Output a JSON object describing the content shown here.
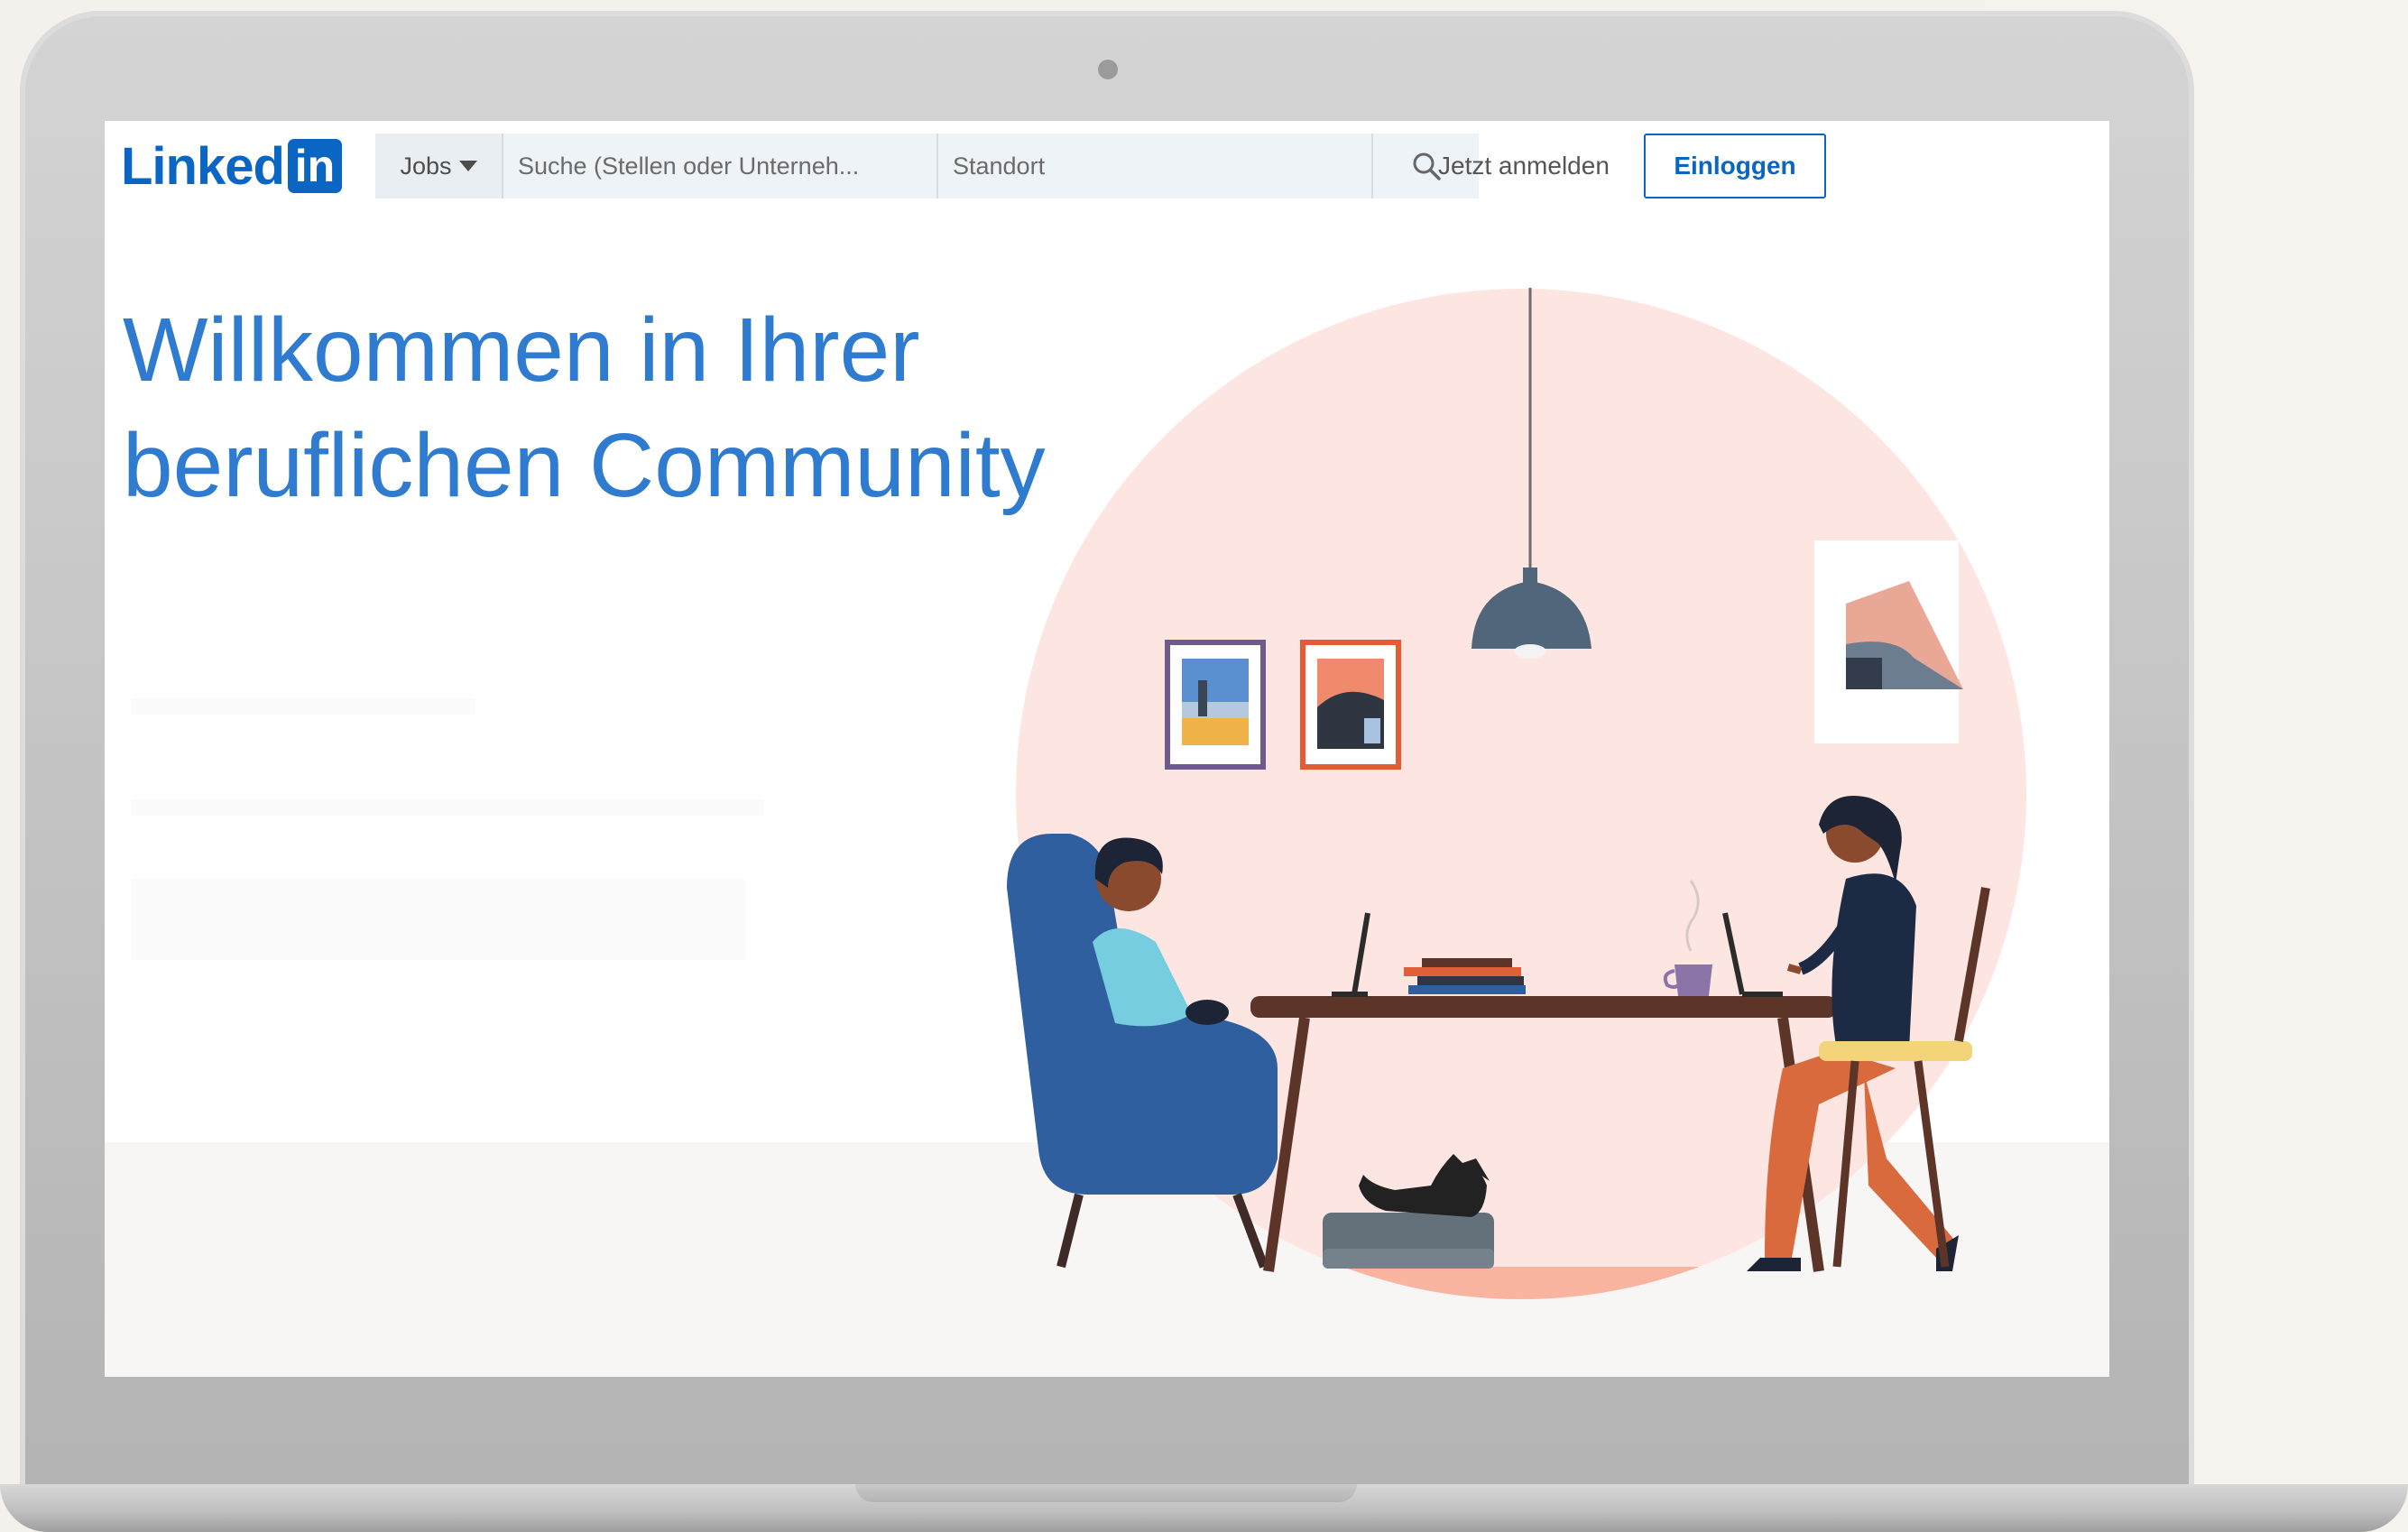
{
  "header": {
    "logo_text": "Linked",
    "logo_box_text": "in",
    "jobs_dropdown_label": "Jobs",
    "search_placeholder": "Suche (Stellen oder Unterneh...",
    "location_placeholder": "Standort",
    "signup_label": "Jetzt anmelden",
    "login_label": "Einloggen"
  },
  "hero": {
    "headline_line1": "Willkommen in Ihrer",
    "headline_line2": "beruflichen Community"
  },
  "colors": {
    "brand": "#0a66c2",
    "headline": "#2e7bcf",
    "circle_bg": "#fde6e2",
    "floor_circle": "#f9b4a0"
  },
  "icons": {
    "search": "search-icon",
    "dropdown": "caret-down-icon"
  }
}
